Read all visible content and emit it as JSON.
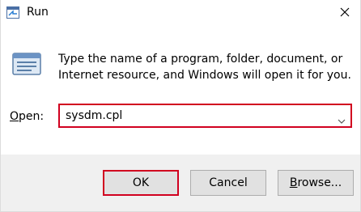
{
  "window": {
    "title": "Run",
    "close_icon": "close-icon",
    "app_icon": "run-app-icon"
  },
  "content": {
    "icon": "run-program-icon",
    "description": "Type the name of a program, folder, document, or Internet resource, and Windows will open it for you.",
    "open_label_accesskey": "O",
    "open_label_rest": "pen:",
    "open_value": "sysdm.cpl",
    "dropdown_icon": "chevron-down-icon"
  },
  "buttons": {
    "ok": "OK",
    "cancel": "Cancel",
    "browse_accesskey": "B",
    "browse_rest": "rowse..."
  },
  "colors": {
    "highlight_border": "#d1001f",
    "footer_bg": "#f0f0f0",
    "button_bg": "#e1e1e1"
  }
}
